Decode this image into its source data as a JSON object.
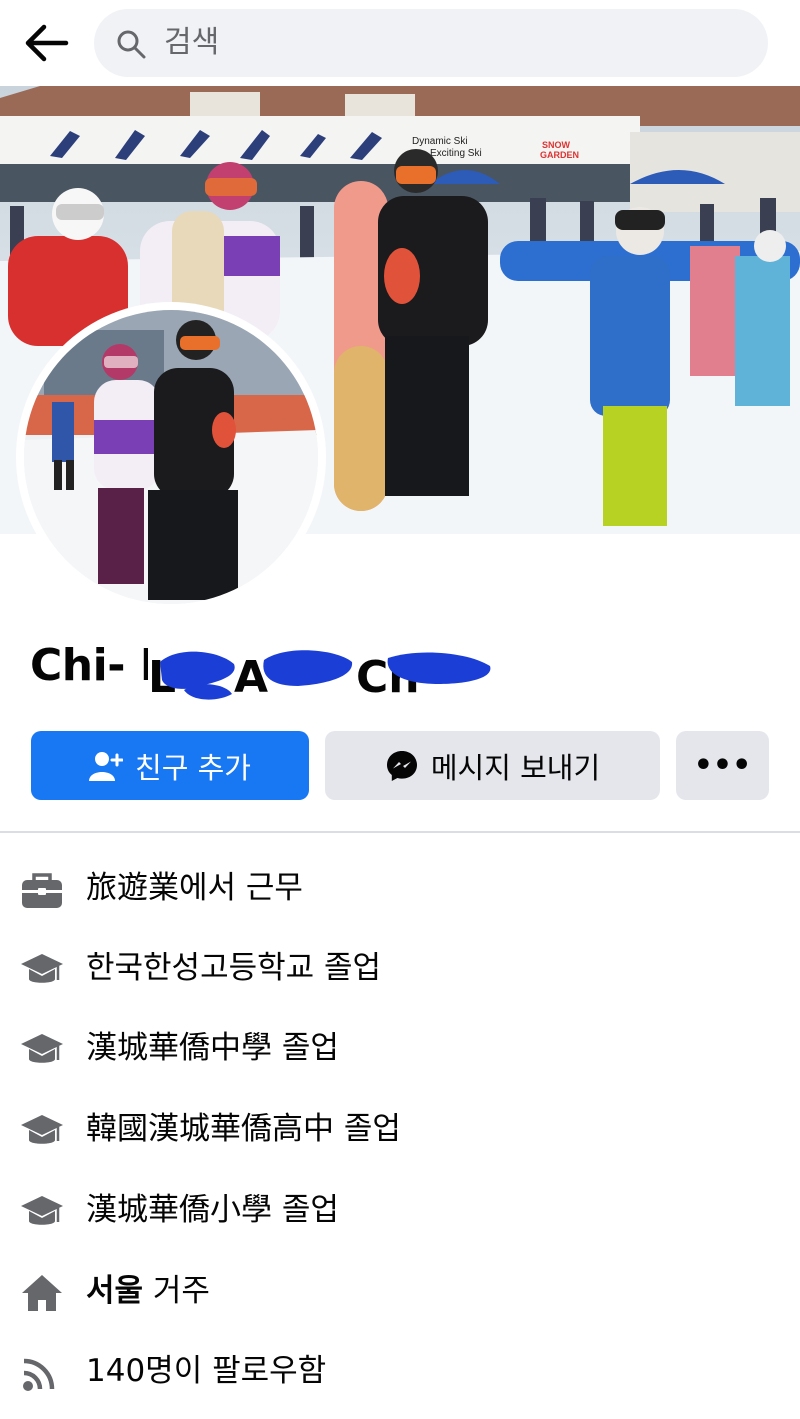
{
  "search": {
    "placeholder": "검색"
  },
  "profile": {
    "name": "Chi- L___ A___ Ch___"
  },
  "actions": {
    "add_friend": "친구 추가",
    "message": "메시지 보내기",
    "more": "•••"
  },
  "intro": [
    {
      "icon": "briefcase-icon",
      "text": "旅遊業에서 근무"
    },
    {
      "icon": "graduation-cap-icon",
      "text": "한국한성고등학교 졸업"
    },
    {
      "icon": "graduation-cap-icon",
      "text": "漢城華僑中學 졸업"
    },
    {
      "icon": "graduation-cap-icon",
      "text": "韓國漢城華僑高中 졸업"
    },
    {
      "icon": "graduation-cap-icon",
      "text": "漢城華僑小學 졸업"
    },
    {
      "icon": "home-icon",
      "bold": "서울",
      "text": " 거주"
    },
    {
      "icon": "rss-icon",
      "text": "140명이 팔로우함"
    }
  ],
  "cover": {
    "signs": [
      "Dynamic Ski",
      "Exciting Ski",
      "SNOW GARDEN"
    ]
  },
  "colors": {
    "accent": "#1877f2",
    "secondary_button": "#e4e6eb",
    "scribble": "#1b3fd6"
  }
}
